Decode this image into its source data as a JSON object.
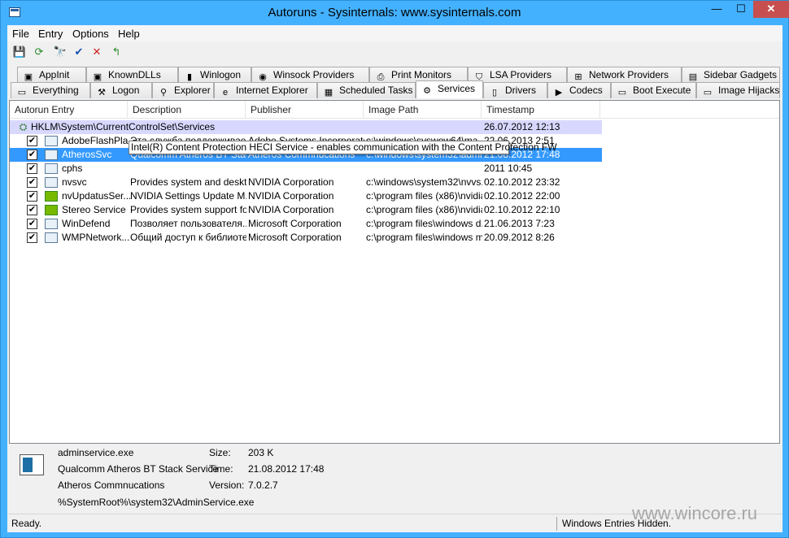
{
  "window": {
    "title": "Autoruns - Sysinternals: www.sysinternals.com",
    "min": "—",
    "max": "☐",
    "close": "✕"
  },
  "menu": [
    "File",
    "Entry",
    "Options",
    "Help"
  ],
  "toolbar": [
    {
      "icon": "save-icon",
      "glyph": "💾"
    },
    {
      "icon": "refresh-icon",
      "glyph": "⟳"
    },
    {
      "icon": "find-icon",
      "glyph": "🔭"
    },
    {
      "icon": "verify-icon",
      "glyph": "✔"
    },
    {
      "icon": "delete-icon",
      "glyph": "✕"
    },
    {
      "icon": "jump-icon",
      "glyph": "↰"
    }
  ],
  "tabs_row1": [
    {
      "label": "AppInit",
      "icon": "appinit-icon",
      "glyph": "▣"
    },
    {
      "label": "KnownDLLs",
      "icon": "knowndlls-icon",
      "glyph": "▣"
    },
    {
      "label": "Winlogon",
      "icon": "winlogon-icon",
      "glyph": "▮"
    },
    {
      "label": "Winsock Providers",
      "icon": "winsock-icon",
      "glyph": "◉"
    },
    {
      "label": "Print Monitors",
      "icon": "printer-icon",
      "glyph": "⎙"
    },
    {
      "label": "LSA Providers",
      "icon": "shield-icon",
      "glyph": "⛉"
    },
    {
      "label": "Network Providers",
      "icon": "network-icon",
      "glyph": "⊞"
    },
    {
      "label": "Sidebar Gadgets",
      "icon": "gadget-icon",
      "glyph": "▤"
    }
  ],
  "tabs_row2": [
    {
      "label": "Everything",
      "icon": "everything-icon",
      "glyph": "▭"
    },
    {
      "label": "Logon",
      "icon": "logon-icon",
      "glyph": "⚒"
    },
    {
      "label": "Explorer",
      "icon": "explorer-icon",
      "glyph": "⚲"
    },
    {
      "label": "Internet Explorer",
      "icon": "ie-icon",
      "glyph": "e"
    },
    {
      "label": "Scheduled Tasks",
      "icon": "tasks-icon",
      "glyph": "▦"
    },
    {
      "label": "Services",
      "icon": "gears-icon",
      "glyph": "⚙"
    },
    {
      "label": "Drivers",
      "icon": "drivers-icon",
      "glyph": "▯"
    },
    {
      "label": "Codecs",
      "icon": "codecs-icon",
      "glyph": "▶"
    },
    {
      "label": "Boot Execute",
      "icon": "boot-icon",
      "glyph": "▭"
    },
    {
      "label": "Image Hijacks",
      "icon": "hijack-icon",
      "glyph": "▭"
    }
  ],
  "columns": [
    "Autorun Entry",
    "Description",
    "Publisher",
    "Image Path",
    "Timestamp"
  ],
  "group": {
    "key": "HKLM\\System\\CurrentControlSet\\Services",
    "timestamp": "26.07.2012 12:13"
  },
  "rows": [
    {
      "entry": "AdobeFlashPla...",
      "desc": "Эта служба поддерживае...",
      "pub": "Adobe Systems Incorporated",
      "path": "c:\\windows\\syswow64\\ma...",
      "time": "22.06.2013 2:51",
      "nv": false
    },
    {
      "entry": "AtherosSvc",
      "desc": "Qualcomm Atheros BT Stac...",
      "pub": "Atheros Commnucations",
      "path": "c:\\windows\\system32\\admi...",
      "time": "21.08.2012 17:48",
      "nv": false
    },
    {
      "entry": "cphs",
      "desc": "",
      "pub": "",
      "path": "",
      "time": "2011 10:45",
      "nv": false
    },
    {
      "entry": "nvsvc",
      "desc": "Provides system and deskto...",
      "pub": "NVIDIA Corporation",
      "path": "c:\\windows\\system32\\nvvs...",
      "time": "02.10.2012 23:32",
      "nv": false
    },
    {
      "entry": "nvUpdatusSer...",
      "desc": "NVIDIA Settings Update M...",
      "pub": "NVIDIA Corporation",
      "path": "c:\\program files (x86)\\nvidia...",
      "time": "02.10.2012 22:00",
      "nv": true
    },
    {
      "entry": "Stereo Service",
      "desc": "Provides system support for ...",
      "pub": "NVIDIA Corporation",
      "path": "c:\\program files (x86)\\nvidia...",
      "time": "02.10.2012 22:10",
      "nv": true
    },
    {
      "entry": "WinDefend",
      "desc": "Позволяет пользователя...",
      "pub": "Microsoft Corporation",
      "path": "c:\\program files\\windows d...",
      "time": "21.06.2013 7:23",
      "nv": false
    },
    {
      "entry": "WMPNetwork...",
      "desc": "Общий доступ к библиоте...",
      "pub": "Microsoft Corporation",
      "path": "c:\\program files\\windows m...",
      "time": "20.09.2012 8:26",
      "nv": false
    }
  ],
  "selected_row": 1,
  "tooltip": "Intel(R) Content Protection HECI Service - enables communication with the Content Protection FW",
  "details": {
    "file": "adminservice.exe",
    "description": "Qualcomm Atheros BT Stack Service",
    "publisher": "Atheros Commnucations",
    "path": "%SystemRoot%\\system32\\AdminService.exe",
    "size_label": "Size:",
    "size": "203 K",
    "time_label": "Time:",
    "time": "21.08.2012 17:48",
    "version_label": "Version:",
    "version": "7.0.2.7"
  },
  "status": {
    "left": "Ready.",
    "right": "Windows Entries Hidden."
  },
  "watermark": "www.wincore.ru"
}
